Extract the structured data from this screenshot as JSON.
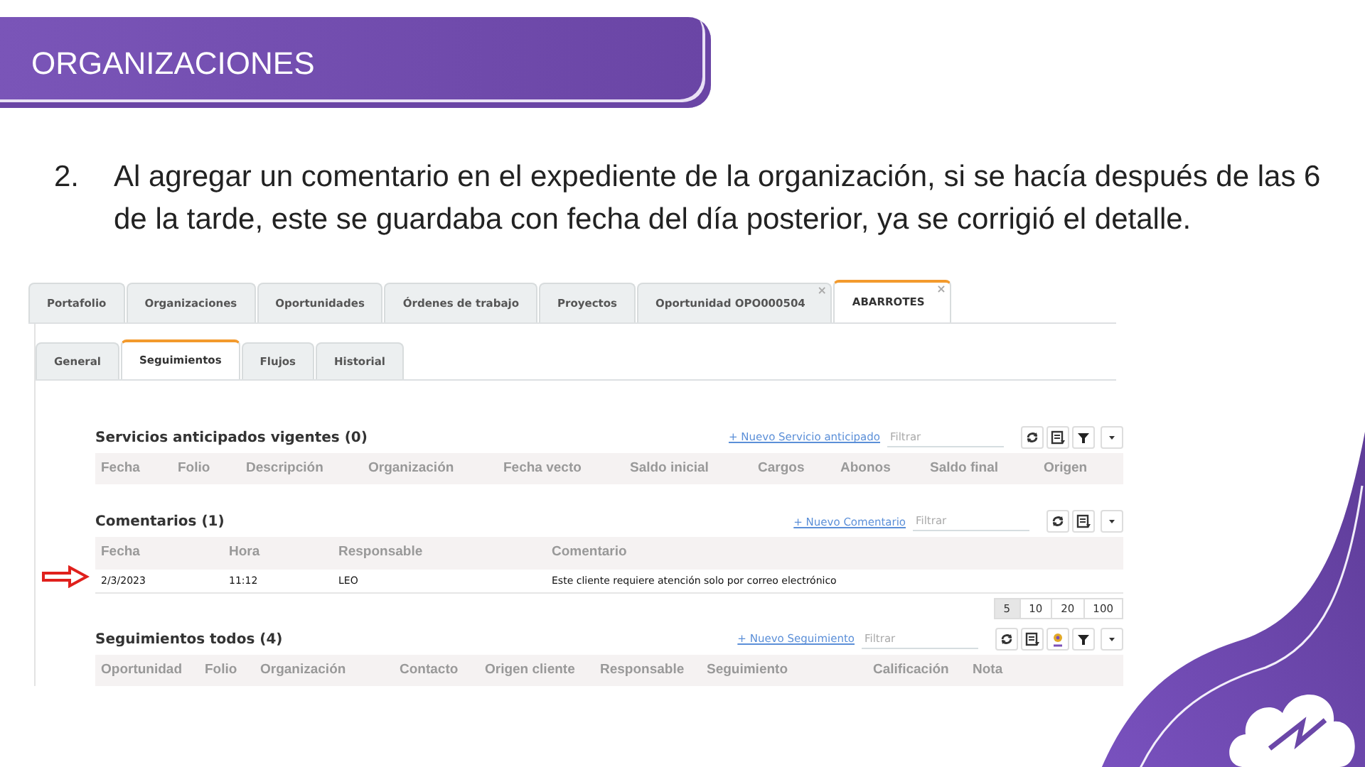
{
  "slide": {
    "title": "ORGANIZACIONES"
  },
  "list_item": {
    "number": "2.",
    "text": "Al agregar un comentario en el expediente de la organización, si se hacía después de las 6 de la tarde, este se guardaba con fecha del día posterior, ya se corrigió el detalle."
  },
  "app": {
    "tabs": [
      {
        "label": "Portafolio",
        "selected": false
      },
      {
        "label": "Organizaciones",
        "selected": false
      },
      {
        "label": "Oportunidades",
        "selected": false
      },
      {
        "label": "Órdenes de trabajo",
        "selected": false
      },
      {
        "label": "Proyectos",
        "selected": false
      },
      {
        "label": "Oportunidad OPO000504",
        "selected": false,
        "close": "×"
      },
      {
        "label": "ABARROTES",
        "selected": true,
        "close": "×"
      }
    ],
    "subtabs": [
      {
        "label": "General",
        "selected": false
      },
      {
        "label": "Seguimientos",
        "selected": true
      },
      {
        "label": "Flujos",
        "selected": false
      },
      {
        "label": "Historial",
        "selected": false
      }
    ],
    "sections": [
      {
        "title": "Servicios anticipados vigentes (0)",
        "action": "+ Nuevo Servicio anticipado",
        "filter_placeholder": "Filtrar",
        "tools": [
          {
            "kind": "refresh"
          },
          {
            "kind": "export"
          },
          {
            "kind": "filter"
          },
          {
            "kind": "dropdown"
          }
        ],
        "columns": [
          "Fecha",
          "Folio",
          "Descripción",
          "Organización",
          "Fecha vecto",
          "Saldo inicial",
          "Cargos",
          "Abonos",
          "Saldo final",
          "Origen"
        ]
      },
      {
        "title": "Comentarios (1)",
        "action": "+ Nuevo Comentario",
        "filter_placeholder": "Filtrar",
        "tools": [
          {
            "kind": "refresh"
          },
          {
            "kind": "export"
          },
          {
            "kind": "dropdown"
          }
        ],
        "columns": [
          "Fecha",
          "Hora",
          "Responsable",
          "Comentario"
        ],
        "rows": [
          {
            "cells": [
              "2/3/2023",
              "11:12",
              "LEO",
              "Este cliente requiere atención solo por correo electrónico"
            ],
            "marked": true
          }
        ],
        "pages": [
          {
            "label": "5",
            "selected": true
          },
          {
            "label": "10",
            "selected": false
          },
          {
            "label": "20",
            "selected": false
          },
          {
            "label": "100",
            "selected": false
          }
        ]
      },
      {
        "title": "Seguimientos todos (4)",
        "action": "+ Nuevo Seguimiento",
        "filter_placeholder": "Filtrar",
        "tools": [
          {
            "kind": "refresh"
          },
          {
            "kind": "export"
          },
          {
            "kind": "pin"
          },
          {
            "kind": "filter"
          },
          {
            "kind": "dropdown"
          }
        ],
        "columns": [
          "Oportunidad",
          "Folio",
          "Organización",
          "Contacto",
          "Origen cliente",
          "Responsable",
          "Seguimiento",
          "Calificación",
          "Nota"
        ]
      }
    ]
  }
}
